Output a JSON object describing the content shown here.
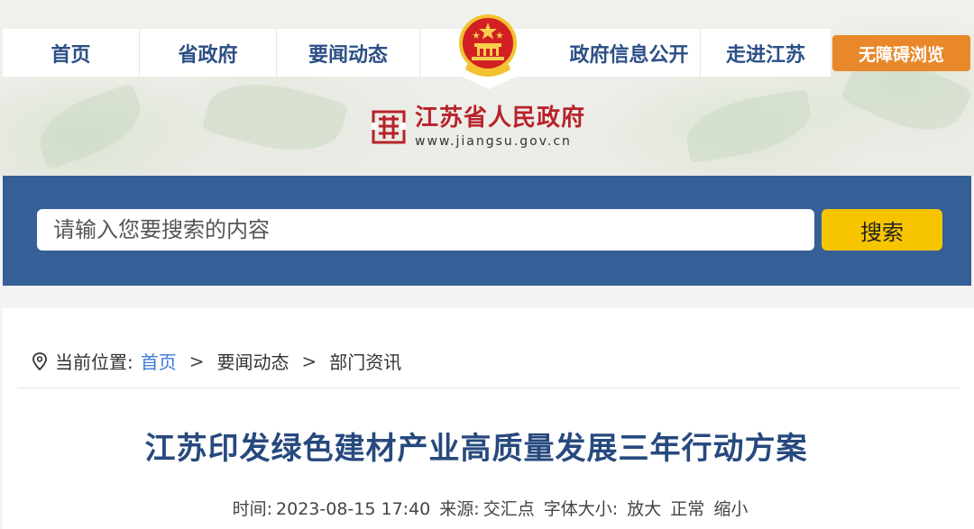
{
  "nav": {
    "items": [
      "首页",
      "省政府",
      "要闻动态",
      "政府信息公开",
      "走进江苏"
    ],
    "accessibility_label": "无障碍浏览"
  },
  "logo": {
    "name": "江苏省人民政府",
    "url_text": "www.jiangsu.gov.cn"
  },
  "search": {
    "placeholder": "请输入您要搜索的内容",
    "button_label": "搜索"
  },
  "breadcrumb": {
    "label": "当前位置:",
    "items": [
      "首页",
      "要闻动态",
      "部门资讯"
    ],
    "separator": ">"
  },
  "article": {
    "title": "江苏印发绿色建材产业高质量发展三年行动方案",
    "time_label": "时间:",
    "time": "2023-08-15 17:40",
    "source_label": "来源:",
    "source": "交汇点",
    "font_size_label": "字体大小:",
    "font_options": [
      "放大",
      "正常",
      "缩小"
    ]
  },
  "colors": {
    "nav_text": "#2c4f86",
    "accent_orange": "#e8882a",
    "search_band": "#355f96",
    "search_button": "#f7c500",
    "title": "#27497e",
    "logo_red": "#b8222a"
  },
  "icons": [
    "national-emblem-icon",
    "jiangsu-logo-icon",
    "location-pin-icon"
  ]
}
